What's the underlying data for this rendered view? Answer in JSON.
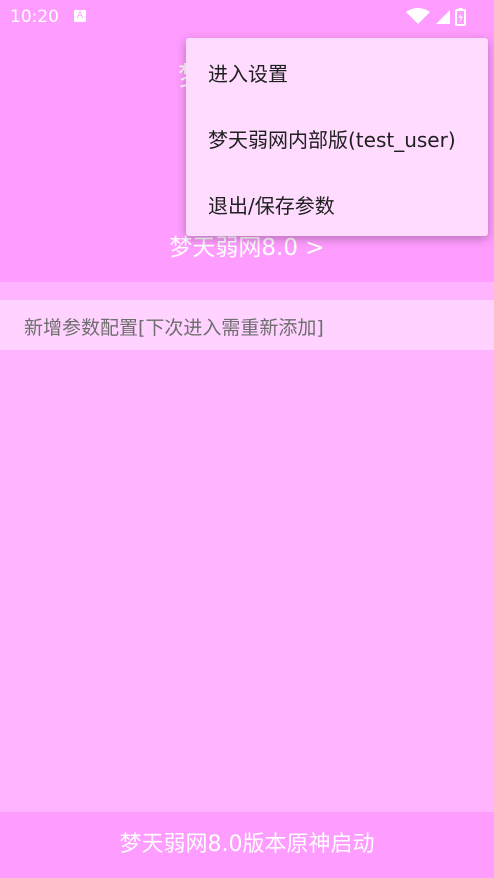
{
  "status_bar": {
    "time": "10:20",
    "notification_glyph": "A",
    "icons": [
      "wifi-icon",
      "signal-icon",
      "battery-charging-icon"
    ]
  },
  "header": {
    "title_fragment": "梦",
    "subtitle": "梦天弱网8.0 >"
  },
  "main": {
    "add_config_label": "新增参数配置[下次进入需重新添加]"
  },
  "footer": {
    "launch_label": "梦天弱网8.0版本原神启动"
  },
  "overflow_menu": {
    "items": [
      {
        "label": "进入设置"
      },
      {
        "label": "梦天弱网内部版(test_user)"
      },
      {
        "label": "退出/保存参数"
      }
    ]
  },
  "colors": {
    "primary": "#ff9cff",
    "background": "#ffb4ff",
    "card": "#ffd2ff",
    "menu_background": "#ffdcff",
    "text_on_primary": "#ffffff"
  }
}
